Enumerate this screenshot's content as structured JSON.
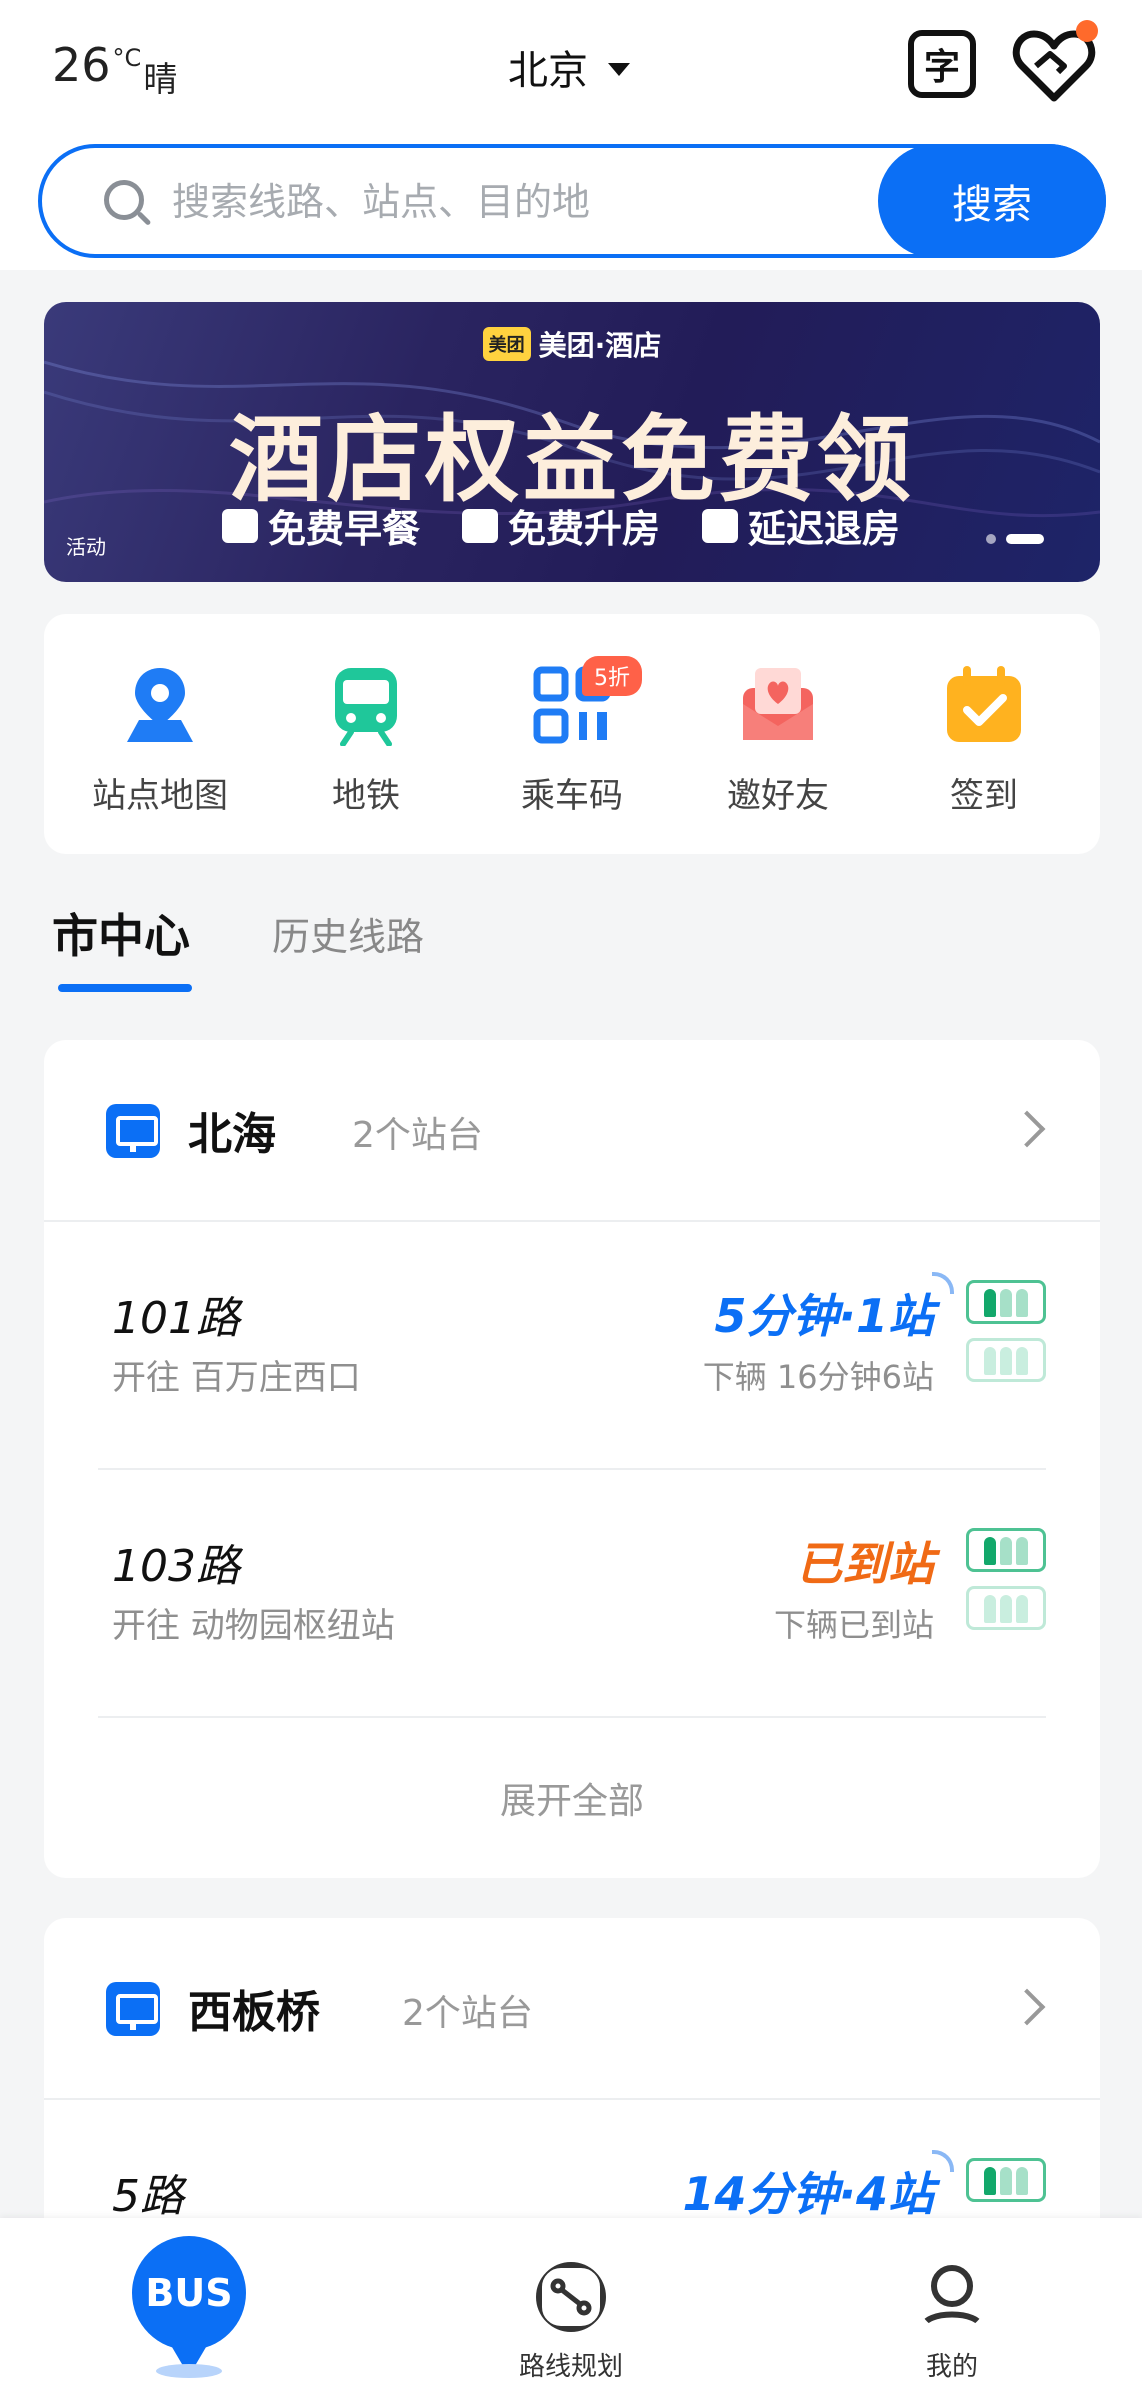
{
  "header": {
    "temperature": "26",
    "temp_unit": "°C",
    "weather": "晴",
    "city": "北京",
    "scan_icon_text": "字"
  },
  "search": {
    "placeholder": "搜索线路、站点、目的地",
    "button_label": "搜索"
  },
  "banner": {
    "brand": "美团·酒店",
    "brand_logo": "美团",
    "headline": "酒店权益免费领",
    "perks": [
      "免费早餐",
      "免费升房",
      "延迟退房"
    ],
    "tag": "活动"
  },
  "quick_actions": [
    {
      "label": "站点地图",
      "icon": "map-pin-icon",
      "color": "#1f7cf5"
    },
    {
      "label": "地铁",
      "icon": "subway-icon",
      "color": "#1fc79a"
    },
    {
      "label": "乘车码",
      "icon": "qr-code-icon",
      "color": "#1f7cf5",
      "badge": "5折"
    },
    {
      "label": "邀好友",
      "icon": "invite-envelope-icon",
      "color": "#f4645f"
    },
    {
      "label": "签到",
      "icon": "calendar-check-icon",
      "color": "#ffb21f"
    }
  ],
  "tabs": {
    "active": "市中心",
    "other": "历史线路"
  },
  "stations": [
    {
      "name": "北海",
      "platforms": "2个站台",
      "routes": [
        {
          "name": "101路",
          "direction": "开往 百万庄西口",
          "eta": "5分钟·1站",
          "eta_style": "blue",
          "next": "下辆 16分钟6站"
        },
        {
          "name": "103路",
          "direction": "开往 动物园枢纽站",
          "eta": "已到站",
          "eta_style": "orange",
          "next": "下辆已到站"
        }
      ],
      "expand_label": "展开全部"
    },
    {
      "name": "西板桥",
      "platforms": "2个站台",
      "routes": [
        {
          "name": "5路",
          "eta": "14分钟·4站",
          "eta_style": "blue"
        }
      ]
    }
  ],
  "bottom_nav": {
    "bus_label": "BUS",
    "route_plan": "路线规划",
    "mine": "我的"
  },
  "colors": {
    "accent": "#0b6ff5",
    "arrived": "#f06a15",
    "crowd_green": "#13a86b"
  }
}
